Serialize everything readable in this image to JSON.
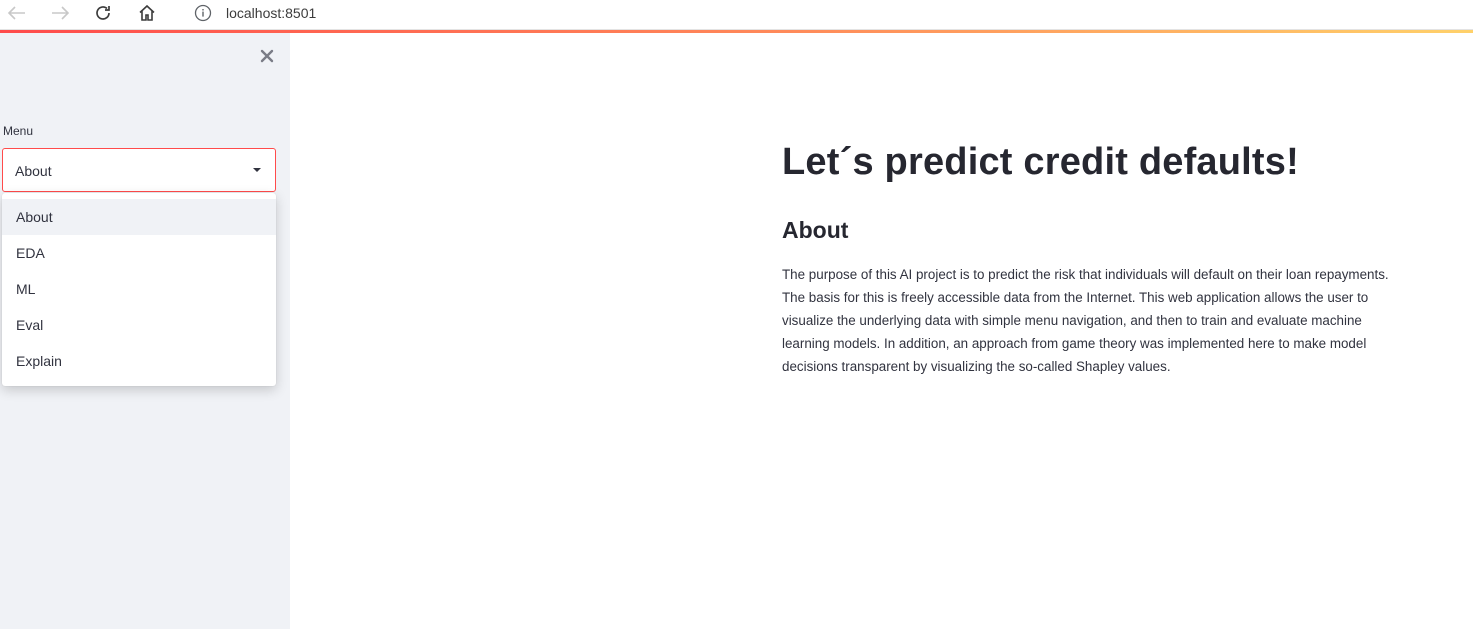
{
  "browser": {
    "url": "localhost:8501"
  },
  "sidebar": {
    "menu_label": "Menu",
    "selected_value": "About",
    "options": [
      "About",
      "EDA",
      "ML",
      "Eval",
      "Explain"
    ]
  },
  "main": {
    "title": "Let´s predict credit defaults!",
    "subtitle": "About",
    "body": "The purpose of this AI project is to predict the risk that individuals will default on their loan repayments. The basis for this is freely accessible data from the Internet. This web application allows the user to visualize the underlying data with simple menu navigation, and then to train and evaluate machine learning models. In addition, an approach from game theory was implemented here to make model decisions transparent by visualizing the so-called Shapley values."
  },
  "colors": {
    "accent": "#ff4b4b",
    "sidebar_bg": "#f0f2f6",
    "text": "#31333f"
  }
}
